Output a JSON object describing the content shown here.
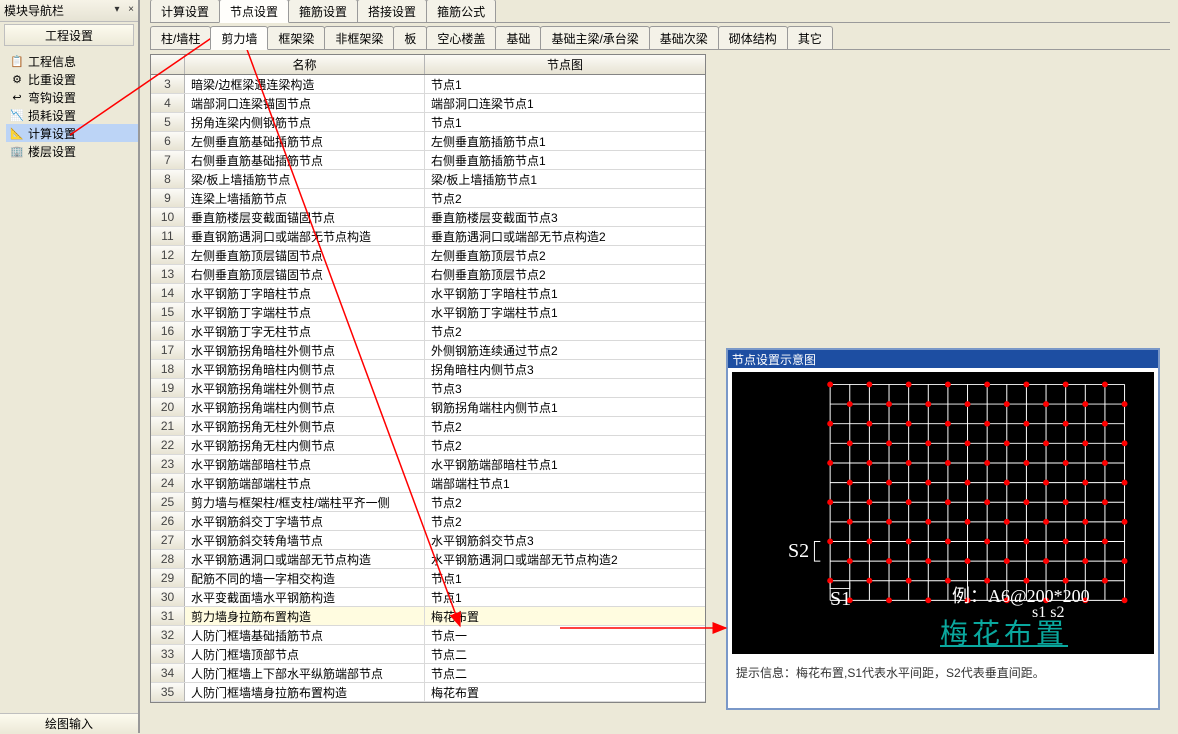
{
  "nav": {
    "title": "模块导航栏",
    "section_button": "工程设置",
    "items": [
      {
        "icon": "📋",
        "label": "工程信息"
      },
      {
        "icon": "⚙",
        "label": "比重设置"
      },
      {
        "icon": "↩",
        "label": "弯钩设置"
      },
      {
        "icon": "📉",
        "label": "损耗设置"
      },
      {
        "icon": "📐",
        "label": "计算设置",
        "selected": true
      },
      {
        "icon": "🏢",
        "label": "楼层设置"
      }
    ],
    "footer": "绘图输入"
  },
  "tabs1": [
    {
      "label": "计算设置"
    },
    {
      "label": "节点设置",
      "active": true
    },
    {
      "label": "箍筋设置"
    },
    {
      "label": "搭接设置"
    },
    {
      "label": "箍筋公式"
    }
  ],
  "tabs2": [
    {
      "label": "柱/墙柱"
    },
    {
      "label": "剪力墙",
      "active": true
    },
    {
      "label": "框架梁"
    },
    {
      "label": "非框架梁"
    },
    {
      "label": "板"
    },
    {
      "label": "空心楼盖"
    },
    {
      "label": "基础"
    },
    {
      "label": "基础主梁/承台梁"
    },
    {
      "label": "基础次梁"
    },
    {
      "label": "砌体结构"
    },
    {
      "label": "其它"
    }
  ],
  "grid": {
    "col_name": "名称",
    "col_val": "节点图",
    "rows": [
      {
        "n": 3,
        "name": "暗梁/边框梁遇连梁构造",
        "val": "节点1"
      },
      {
        "n": 4,
        "name": "端部洞口连梁锚固节点",
        "val": "端部洞口连梁节点1"
      },
      {
        "n": 5,
        "name": "拐角连梁内侧钢筋节点",
        "val": "节点1"
      },
      {
        "n": 6,
        "name": "左侧垂直筋基础插筋节点",
        "val": "左侧垂直筋插筋节点1"
      },
      {
        "n": 7,
        "name": "右侧垂直筋基础插筋节点",
        "val": "右侧垂直筋插筋节点1"
      },
      {
        "n": 8,
        "name": "梁/板上墙插筋节点",
        "val": "梁/板上墙插筋节点1"
      },
      {
        "n": 9,
        "name": "连梁上墙插筋节点",
        "val": "节点2"
      },
      {
        "n": 10,
        "name": "垂直筋楼层变截面锚固节点",
        "val": "垂直筋楼层变截面节点3"
      },
      {
        "n": 11,
        "name": "垂直钢筋遇洞口或端部无节点构造",
        "val": "垂直筋遇洞口或端部无节点构造2"
      },
      {
        "n": 12,
        "name": "左侧垂直筋顶层锚固节点",
        "val": "左侧垂直筋顶层节点2"
      },
      {
        "n": 13,
        "name": "右侧垂直筋顶层锚固节点",
        "val": "右侧垂直筋顶层节点2"
      },
      {
        "n": 14,
        "name": "水平钢筋丁字暗柱节点",
        "val": "水平钢筋丁字暗柱节点1"
      },
      {
        "n": 15,
        "name": "水平钢筋丁字端柱节点",
        "val": "水平钢筋丁字端柱节点1"
      },
      {
        "n": 16,
        "name": "水平钢筋丁字无柱节点",
        "val": "节点2"
      },
      {
        "n": 17,
        "name": "水平钢筋拐角暗柱外侧节点",
        "val": "外侧钢筋连续通过节点2"
      },
      {
        "n": 18,
        "name": "水平钢筋拐角暗柱内侧节点",
        "val": "拐角暗柱内侧节点3"
      },
      {
        "n": 19,
        "name": "水平钢筋拐角端柱外侧节点",
        "val": "节点3"
      },
      {
        "n": 20,
        "name": "水平钢筋拐角端柱内侧节点",
        "val": "钢筋拐角端柱内侧节点1"
      },
      {
        "n": 21,
        "name": "水平钢筋拐角无柱外侧节点",
        "val": "节点2"
      },
      {
        "n": 22,
        "name": "水平钢筋拐角无柱内侧节点",
        "val": "节点2"
      },
      {
        "n": 23,
        "name": "水平钢筋端部暗柱节点",
        "val": "水平钢筋端部暗柱节点1"
      },
      {
        "n": 24,
        "name": "水平钢筋端部端柱节点",
        "val": "端部端柱节点1"
      },
      {
        "n": 25,
        "name": "剪力墙与框架柱/框支柱/端柱平齐一侧",
        "val": "节点2"
      },
      {
        "n": 26,
        "name": "水平钢筋斜交丁字墙节点",
        "val": "节点2"
      },
      {
        "n": 27,
        "name": "水平钢筋斜交转角墙节点",
        "val": "水平钢筋斜交节点3"
      },
      {
        "n": 28,
        "name": "水平钢筋遇洞口或端部无节点构造",
        "val": "水平钢筋遇洞口或端部无节点构造2"
      },
      {
        "n": 29,
        "name": "配筋不同的墙一字相交构造",
        "val": "节点1"
      },
      {
        "n": 30,
        "name": "水平变截面墙水平钢筋构造",
        "val": "节点1"
      },
      {
        "n": 31,
        "name": "剪力墙身拉筋布置构造",
        "val": "梅花布置",
        "selected": true
      },
      {
        "n": 32,
        "name": "人防门框墙基础插筋节点",
        "val": "节点一"
      },
      {
        "n": 33,
        "name": "人防门框墙顶部节点",
        "val": "节点二"
      },
      {
        "n": 34,
        "name": "人防门框墙上下部水平纵筋端部节点",
        "val": "节点二"
      },
      {
        "n": 35,
        "name": "人防门框墙墙身拉筋布置构造",
        "val": "梅花布置"
      }
    ]
  },
  "preview": {
    "title": "节点设置示意图",
    "pattern_label": "梅花布置",
    "s1": "S1",
    "s2": "S2",
    "example": "例：A6@200*200",
    "example2": "s1   s2",
    "hint": "提示信息：梅花布置,S1代表水平间距，S2代表垂直间距。"
  }
}
